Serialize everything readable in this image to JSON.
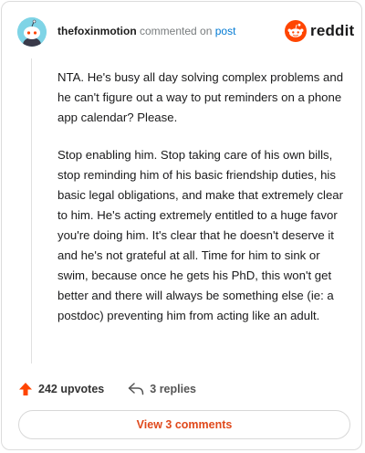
{
  "header": {
    "username": "thefoxinmotion",
    "action": "commented on",
    "link": "post",
    "brand": "reddit"
  },
  "comment": {
    "paragraphs": [
      "NTA. He's busy all day solving complex problems and he can't figure out a way to put reminders on a phone app calendar? Please.",
      "Stop enabling him. Stop taking care of his own bills, stop reminding him of his basic friendship duties, his basic legal obligations, and make that extremely clear to him. He's acting extremely entitled to a huge favor you're doing him. It's clear that he doesn't deserve it and he's not grateful at all. Time for him to sink or swim, because once he gets his PhD, this won't get better and there will always be something else (ie: a postdoc) preventing him from acting like an adult."
    ]
  },
  "footer": {
    "upvotes": "242 upvotes",
    "replies": "3 replies",
    "view_button": "View 3 comments"
  },
  "colors": {
    "reddit_orange": "#ff4500",
    "link_blue": "#0079d3",
    "avatar_bg": "#7fd4e6"
  }
}
